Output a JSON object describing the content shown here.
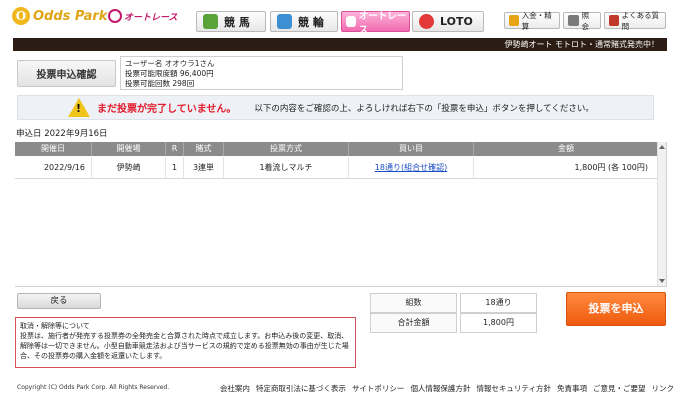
{
  "header": {
    "logo_text": "Odds Park",
    "logo_initial": "O",
    "logo_sub": "オートレース",
    "tabs": [
      {
        "label": "競 馬",
        "color": "#5aa23a"
      },
      {
        "label": "競 輪",
        "color": "#3d8fd3"
      },
      {
        "label": "オートレース",
        "color": "#f06bb0"
      },
      {
        "label": "LOTO",
        "color": "#e23a3a"
      }
    ],
    "utilities": [
      {
        "label": "入金・精算",
        "icon": "money-icon"
      },
      {
        "label": "照会",
        "icon": "document-icon"
      },
      {
        "label": "よくある質問",
        "icon": "question-icon"
      }
    ]
  },
  "banner": {
    "text": "伊勢崎オート モトロト・通常賭式発売中！"
  },
  "confirm": {
    "title": "投票申込確認",
    "user_name": "ユーザー名 オオウラ1さん",
    "limit": "投票可能限度額 96,400円",
    "count": "投票可能回数 298回"
  },
  "warning": {
    "emphasis": "まだ投票が完了していません。",
    "message": "以下の内容をご確認の上、よろしければ右下の「投票を申込」ボタンを押してください。"
  },
  "apply_date": "申込日 2022年9月16日",
  "table": {
    "headers": [
      "開催日",
      "開催場",
      "R",
      "賭式",
      "投票方式",
      "買い目",
      "金額"
    ],
    "rows": [
      [
        "2022/9/16",
        "伊勢崎",
        "1",
        "3連単",
        "1着流しマルチ",
        "18通り(組合せ確認)",
        "1,800円 (各 100円)"
      ]
    ]
  },
  "back_label": "戻る",
  "notice": {
    "title": "取消・解除等について",
    "body": "投票は、施行者が発売する投票券の全発売金と合算された時点で成立します。お申込み後の変更、取消、解除等は一切できません。小型自動車競走法および当サービスの規約で定める投票無効の事由が生じた場合、その投票券の購入金額を返還いたします。"
  },
  "summary": {
    "count_label": "組数",
    "count_value": "18通り",
    "total_label": "合計金額",
    "total_value": "1,800円"
  },
  "submit_label": "投票を申込",
  "copyright": "Copyright (C) Odds Park Corp. All Rights Reserved.",
  "footer_links": [
    "会社案内",
    "特定商取引法に基づく表示",
    "サイトポリシー",
    "個人情報保護方針",
    "情報セキュリティ方針",
    "免責事項",
    "ご意見・ご要望",
    "リンク"
  ]
}
